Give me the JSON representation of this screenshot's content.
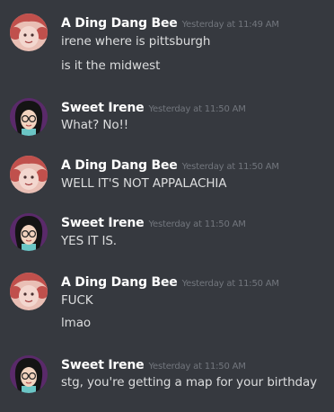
{
  "messages": [
    {
      "author": "A Ding Dang Bee",
      "avatar_icon": "red-haired-avatar",
      "timestamp": "Yesterday at 11:49 AM",
      "lines": [
        "irene where is pittsburgh",
        "is it the midwest"
      ]
    },
    {
      "author": "Sweet Irene",
      "avatar_icon": "glasses-avatar",
      "timestamp": "Yesterday at 11:50 AM",
      "lines": [
        "What? No!!"
      ]
    },
    {
      "author": "A Ding Dang Bee",
      "avatar_icon": "red-haired-avatar",
      "timestamp": "Yesterday at 11:50 AM",
      "lines": [
        "WELL IT'S NOT APPALACHIA"
      ]
    },
    {
      "author": "Sweet Irene",
      "avatar_icon": "glasses-avatar",
      "timestamp": "Yesterday at 11:50 AM",
      "lines": [
        "YES IT IS."
      ]
    },
    {
      "author": "A Ding Dang Bee",
      "avatar_icon": "red-haired-avatar",
      "timestamp": "Yesterday at 11:50 AM",
      "lines": [
        "FUCK",
        "lmao"
      ]
    },
    {
      "author": "Sweet Irene",
      "avatar_icon": "glasses-avatar",
      "timestamp": "Yesterday at 11:50 AM",
      "lines": [
        "stg, you're getting a map for your birthday"
      ]
    }
  ],
  "colors": {
    "background": "#36393f",
    "username": "#ffffff",
    "message_text": "#dcddde",
    "timestamp": "#72767d"
  }
}
